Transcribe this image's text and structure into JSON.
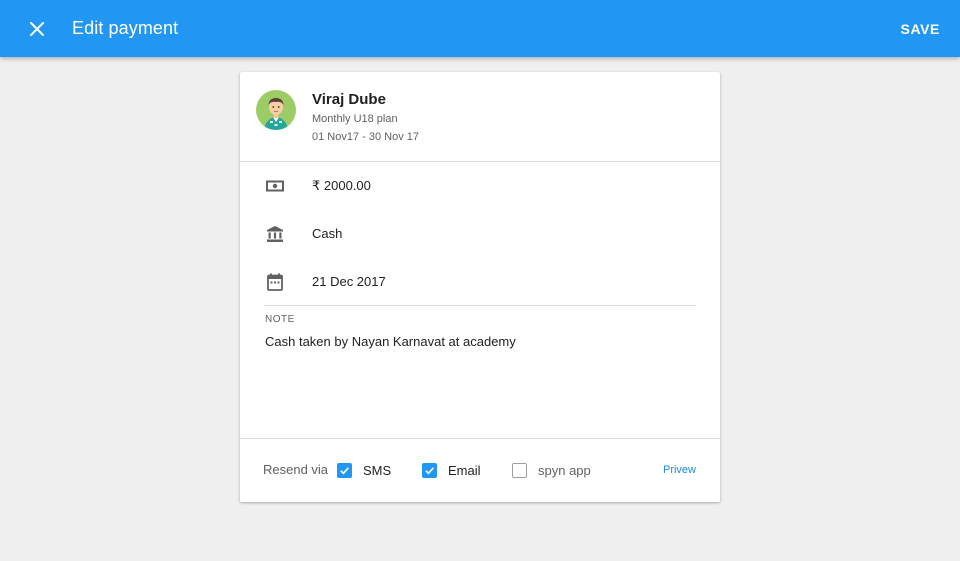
{
  "appbar": {
    "title": "Edit payment",
    "close_icon": "close-icon",
    "save_label": "SAVE",
    "color": "#2196f3"
  },
  "member": {
    "name": "Viraj Dube",
    "plan": "Monthly U18 plan",
    "period": "01 Nov17 - 30 Nov 17",
    "avatar_bg": "#9ccc65"
  },
  "payment": {
    "amount": "₹ 2000.00",
    "amount_icon": "money-icon",
    "method": "Cash",
    "method_icon": "bank-icon",
    "date": "21 Dec 2017",
    "date_icon": "calendar-icon"
  },
  "note": {
    "label": "NOTE",
    "text": "Cash taken by Nayan Karnavat at academy"
  },
  "resend": {
    "label": "Resend via",
    "options": [
      {
        "label": "SMS",
        "checked": true
      },
      {
        "label": "Email",
        "checked": true
      },
      {
        "label": "spyn app",
        "checked": false
      }
    ],
    "preview_label": "Privew"
  }
}
